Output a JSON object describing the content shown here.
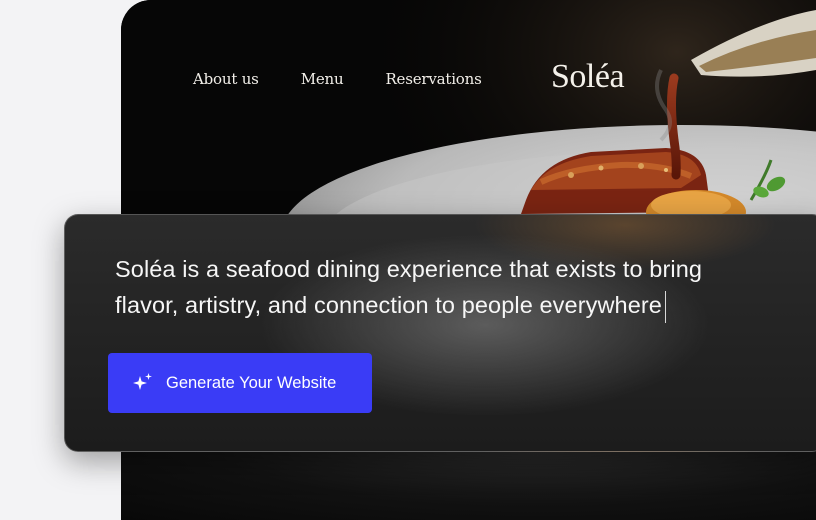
{
  "nav": {
    "items": [
      {
        "label": "About us"
      },
      {
        "label": "Menu"
      },
      {
        "label": "Reservations"
      }
    ]
  },
  "brand": {
    "logo": "Soléa"
  },
  "panel": {
    "tagline_line1": "Soléa is a seafood dining experience that exists to bring",
    "tagline_line2": "flavor, artistry, and connection to people everywhere",
    "button": {
      "label": "Generate Your Website",
      "icon": "sparkles-icon",
      "color": "#3a3cf6"
    }
  },
  "hero": {
    "image": "plated-seafood-dish-with-sauce-pour"
  }
}
